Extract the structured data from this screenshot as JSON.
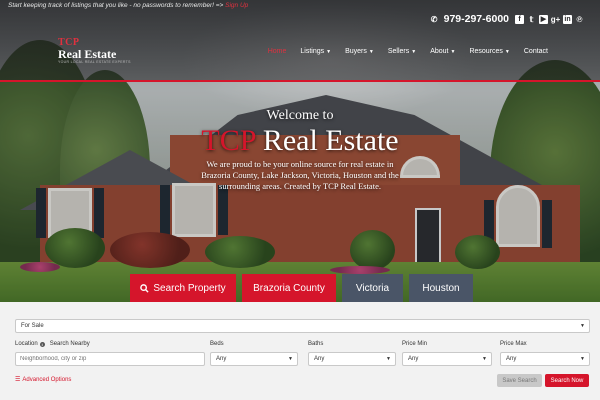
{
  "topbar": {
    "promo_text": "Start keeping track of listings that you like - no passwords to remember!  =>",
    "promo_link": "Sign Up",
    "phone": "979-297-6000",
    "social_icons": [
      "facebook-icon",
      "twitter-icon",
      "youtube-icon",
      "google-plus-icon",
      "linkedin-icon",
      "pinterest-icon"
    ]
  },
  "logo": {
    "line1": "TCP",
    "line2": "Real Estate",
    "tagline": "YOUR LOCAL REAL ESTATE EXPERTS"
  },
  "nav": {
    "items": [
      {
        "label": "Home",
        "active": true,
        "dropdown": false
      },
      {
        "label": "Listings",
        "active": false,
        "dropdown": true
      },
      {
        "label": "Buyers",
        "active": false,
        "dropdown": true
      },
      {
        "label": "Sellers",
        "active": false,
        "dropdown": true
      },
      {
        "label": "About",
        "active": false,
        "dropdown": true
      },
      {
        "label": "Resources",
        "active": false,
        "dropdown": true
      },
      {
        "label": "Contact",
        "active": false,
        "dropdown": false
      }
    ]
  },
  "hero": {
    "welcome": "Welcome to",
    "brand_red": "TCP",
    "brand_white": "Real Estate",
    "subtitle": "We are proud to be your online source for real estate in Brazoria County, Lake Jackson, Victoria, Houston and the surrounding areas. Created by TCP Real Estate."
  },
  "quick_buttons": {
    "search_property": "Search Property",
    "brazoria_county": "Brazoria County",
    "victoria": "Victoria",
    "houston": "Houston"
  },
  "search": {
    "listing_type": "For Sale",
    "location_label": "Location",
    "search_nearby_label": "Search Nearby",
    "location_placeholder": "Neighborhood, city or zip",
    "beds_label": "Beds",
    "beds_value": "Any",
    "baths_label": "Baths",
    "baths_value": "Any",
    "price_min_label": "Price Min",
    "price_min_value": "Any",
    "price_max_label": "Price Max",
    "price_max_value": "Any",
    "advanced_options": "Advanced Options",
    "save_search": "Save Search",
    "search_now": "Search Now"
  },
  "colors": {
    "accent_red": "#d5152b",
    "slate_button": "#4a5567"
  }
}
